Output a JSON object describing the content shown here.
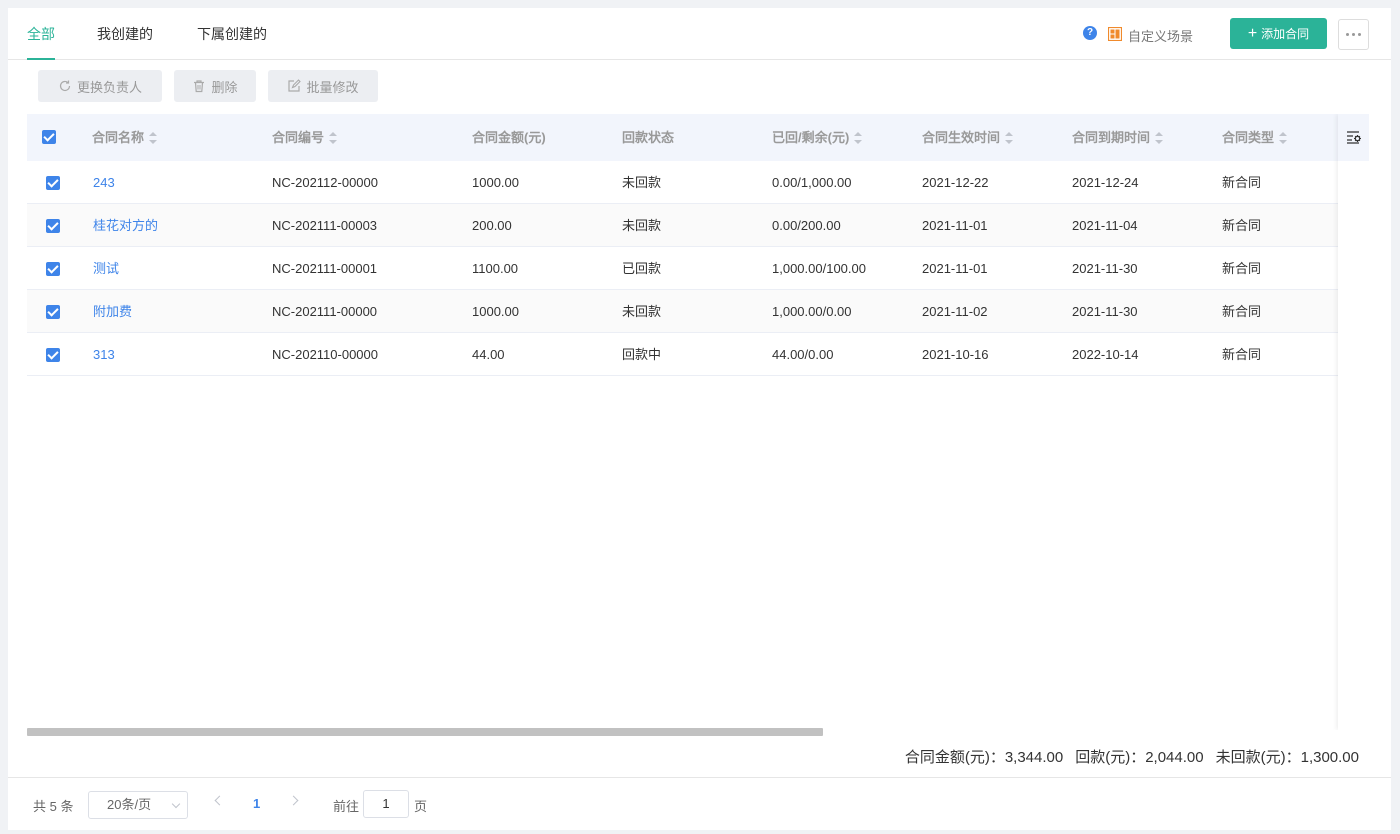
{
  "tabs": [
    {
      "label": "全部",
      "active": true
    },
    {
      "label": "我创建的",
      "active": false
    },
    {
      "label": "下属创建的",
      "active": false
    }
  ],
  "header": {
    "help_icon": "question-icon",
    "scene_label": "自定义场景",
    "add_button": "添加合同",
    "more_icon": "more-icon"
  },
  "toolbar": {
    "change_owner": "更换负责人",
    "delete": "删除",
    "batch_edit": "批量修改"
  },
  "table": {
    "columns": [
      "合同名称",
      "合同编号",
      "合同金额(元)",
      "回款状态",
      "已回/剩余(元)",
      "合同生效时间",
      "合同到期时间",
      "合同类型"
    ],
    "rows": [
      {
        "name": "243",
        "code": "NC-202112-00000",
        "amount": "1000.00",
        "status": "未回款",
        "paid_remain": "0.00/1,000.00",
        "start": "2021-12-22",
        "end": "2021-12-24",
        "type": "新合同"
      },
      {
        "name": "桂花对方的",
        "code": "NC-202111-00003",
        "amount": "200.00",
        "status": "未回款",
        "paid_remain": "0.00/200.00",
        "start": "2021-11-01",
        "end": "2021-11-04",
        "type": "新合同"
      },
      {
        "name": "测试",
        "code": "NC-202111-00001",
        "amount": "1100.00",
        "status": "已回款",
        "paid_remain": "1,000.00/100.00",
        "start": "2021-11-01",
        "end": "2021-11-30",
        "type": "新合同"
      },
      {
        "name": "附加费",
        "code": "NC-202111-00000",
        "amount": "1000.00",
        "status": "未回款",
        "paid_remain": "1,000.00/0.00",
        "start": "2021-11-02",
        "end": "2021-11-30",
        "type": "新合同"
      },
      {
        "name": "313",
        "code": "NC-202110-00000",
        "amount": "44.00",
        "status": "回款中",
        "paid_remain": "44.00/0.00",
        "start": "2021-10-16",
        "end": "2022-10-14",
        "type": "新合同"
      }
    ]
  },
  "summary": {
    "amount": "合同金额(元)：3,344.00",
    "paid": "回款(元)：2,044.00",
    "unpaid": "未回款(元)：1,300.00"
  },
  "pagination": {
    "total": "共 5 条",
    "page_size": "20条/页",
    "current_page": "1",
    "goto_prefix": "前往",
    "goto_value": "1",
    "goto_suffix": "页"
  },
  "colors": {
    "accent": "#2bb398",
    "link": "#3e84e9"
  }
}
